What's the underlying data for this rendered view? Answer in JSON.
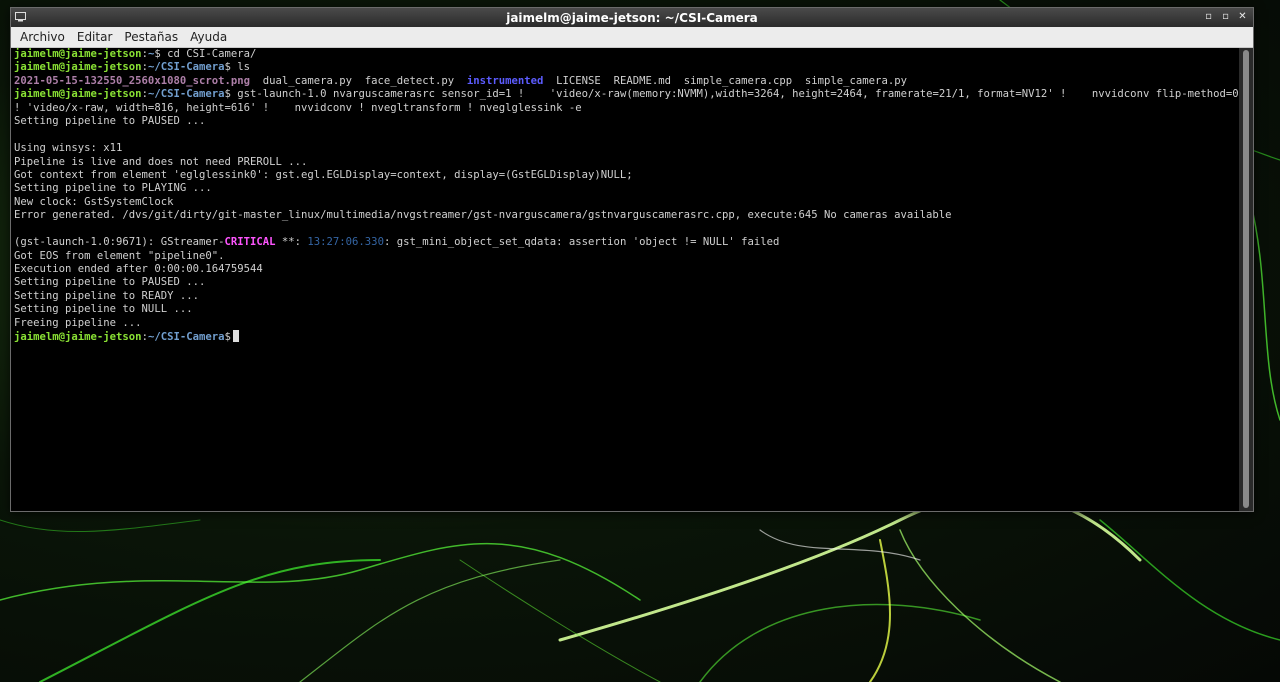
{
  "window": {
    "title": "jaimelm@jaime-jetson: ~/CSI-Camera",
    "controls": {
      "minimize": "▫",
      "maximize": "▫",
      "close": "✕"
    }
  },
  "menu": [
    "Archivo",
    "Editar",
    "Pestañas",
    "Ayuda"
  ],
  "prompt": {
    "user_host": "jaimelm@jaime-jetson",
    "sep": ":",
    "path_home": "~",
    "path_cam": "~/CSI-Camera",
    "symbol": "$"
  },
  "commands": {
    "cd": " cd CSI-Camera/",
    "ls": " ls",
    "gst_line1": " gst-launch-1.0 nvarguscamerasrc sensor_id=1 !    'video/x-raw(memory:NVMM),width=3264, height=2464, framerate=21/1, format=NV12' !    nvvidconv flip-method=0",
    "gst_line2": "! 'video/x-raw, width=816, height=616' !    nvvidconv ! nvegltransform ! nveglglessink -e"
  },
  "ls_output": {
    "png": "2021-05-15-132550_2560x1080_scrot.png",
    "files1": "  dual_camera.py  face_detect.py  ",
    "dir": "instrumented",
    "files2": "  LICENSE  README.md  simple_camera.cpp  simple_camera.py"
  },
  "output": [
    "Setting pipeline to PAUSED ...",
    "",
    "Using winsys: x11",
    "Pipeline is live and does not need PREROLL ...",
    "Got context from element 'eglglessink0': gst.egl.EGLDisplay=context, display=(GstEGLDisplay)NULL;",
    "Setting pipeline to PLAYING ...",
    "New clock: GstSystemClock",
    "Error generated. /dvs/git/dirty/git-master_linux/multimedia/nvgstreamer/gst-nvarguscamera/gstnvarguscamerasrc.cpp, execute:645 No cameras available",
    ""
  ],
  "critical": {
    "prefix": "(gst-launch-1.0:9671): GStreamer-",
    "level": "CRITICAL",
    "stars": " **: ",
    "time": "13:27:06.330",
    "msg": ": gst_mini_object_set_qdata: assertion 'object != NULL' failed"
  },
  "output2": [
    "Got EOS from element \"pipeline0\".",
    "Execution ended after 0:00:00.164759544",
    "Setting pipeline to PAUSED ...",
    "Setting pipeline to READY ...",
    "Setting pipeline to NULL ...",
    "Freeing pipeline ..."
  ]
}
